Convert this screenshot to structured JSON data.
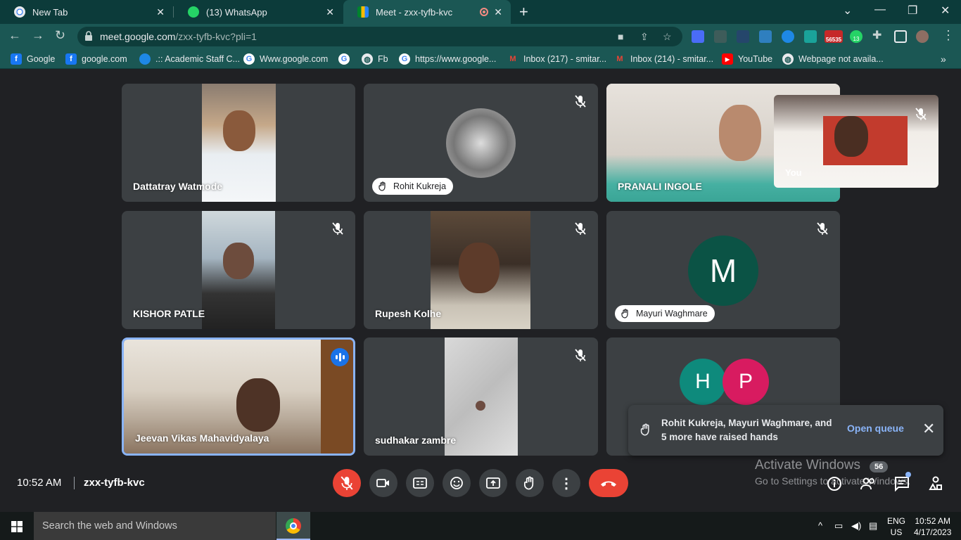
{
  "browser": {
    "tabs": [
      {
        "title": "New Tab",
        "icon": "chrome-icon"
      },
      {
        "title": "(13) WhatsApp",
        "icon": "whatsapp-icon"
      },
      {
        "title": "Meet - zxx-tyfb-kvc",
        "icon": "meet-icon",
        "active": true
      }
    ],
    "url": {
      "host": "meet.google.com",
      "path": "/zxx-tyfb-kvc?pli=1"
    },
    "extension_badges": {
      "gmail": "56535",
      "whatsapp": "13"
    },
    "bookmarks": [
      "Google",
      "google.com",
      ".:: Academic Staff C...",
      "Www.google.com",
      "",
      "Fb",
      "https://www.google...",
      "Inbox (217) - smitar...",
      "Inbox (214) - smitar...",
      "YouTube",
      "Webpage not availa..."
    ]
  },
  "meet": {
    "participants": [
      {
        "name": "Dattatray Watmode",
        "muted": false,
        "hand_raised": false
      },
      {
        "name": "Rohit Kukreja",
        "muted": true,
        "hand_raised": true
      },
      {
        "name": "PRANALI INGOLE",
        "muted": false,
        "hand_raised": false
      },
      {
        "name": "KISHOR PATLE",
        "muted": true,
        "hand_raised": false
      },
      {
        "name": "Rupesh Kolhe",
        "muted": true,
        "hand_raised": false
      },
      {
        "name": "Mayuri Waghmare",
        "muted": true,
        "hand_raised": true,
        "initial": "M"
      },
      {
        "name": "Jeevan Vikas Mahavidyalaya",
        "muted": false,
        "speaking": true
      },
      {
        "name": "sudhakar zambre",
        "muted": true,
        "hand_raised": false
      },
      {
        "name": "",
        "initials": [
          "H",
          "P"
        ]
      }
    ],
    "self_label": "You",
    "notification": {
      "text": "Rohit Kukreja, Mayuri Waghmare, and 5 more have raised hands",
      "action": "Open queue"
    },
    "clock": "10:52 AM",
    "meeting_code": "zxx-tyfb-kvc",
    "people_count": "56",
    "colors": {
      "hangup": "#ea4335",
      "avatar_m": "#0b5345",
      "avatar_h": "#0e8a7c",
      "avatar_p": "#d81b60",
      "link": "#8ab4f8"
    }
  },
  "watermark": {
    "title": "Activate Windows",
    "subtitle": "Go to Settings to activate Windows."
  },
  "taskbar": {
    "search_placeholder": "Search the web and Windows",
    "lang": "ENG",
    "region": "US",
    "time": "10:52 AM",
    "date": "4/17/2023"
  }
}
